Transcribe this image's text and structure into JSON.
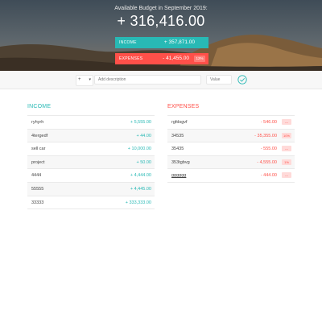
{
  "header": {
    "title": "Available Budget in September 2019:",
    "total": "+ 316,416.00"
  },
  "summary": {
    "income": {
      "label": "Income",
      "value": "+ 357,871.00"
    },
    "expenses": {
      "label": "Expenses",
      "value": "- 41,455.00",
      "percentage": "12%"
    }
  },
  "add_form": {
    "type_symbol": "+",
    "description_placeholder": "Add description",
    "value_placeholder": "Value"
  },
  "income": {
    "title": "Income",
    "items": [
      {
        "description": "ryhyrh",
        "value": "+ 5,555.00"
      },
      {
        "description": "4tergedf",
        "value": "+ 44.00"
      },
      {
        "description": "sell car",
        "value": "+ 10,000.00"
      },
      {
        "description": "project",
        "value": "+ 50.00"
      },
      {
        "description": "4444",
        "value": "+ 4,444.00"
      },
      {
        "description": "55555",
        "value": "+ 4,445.00"
      },
      {
        "description": "33333",
        "value": "+ 333,333.00"
      }
    ]
  },
  "expenses": {
    "title": "Expenses",
    "items": [
      {
        "description": "rgfdsgvf",
        "value": "- 546.00",
        "percentage": "---"
      },
      {
        "description": "34535",
        "value": "- 35,355.00",
        "percentage": "10%"
      },
      {
        "description": "35435",
        "value": "- 555.00",
        "percentage": "---"
      },
      {
        "description": "353tgbvg",
        "value": "- 4,555.00",
        "percentage": "1%"
      },
      {
        "description": "gggggg",
        "value": "- 444.00",
        "percentage": "---"
      }
    ]
  },
  "colors": {
    "income": "#28b9b5",
    "expense": "#ff5049",
    "expense_badge_bg": "#ffdad9"
  }
}
